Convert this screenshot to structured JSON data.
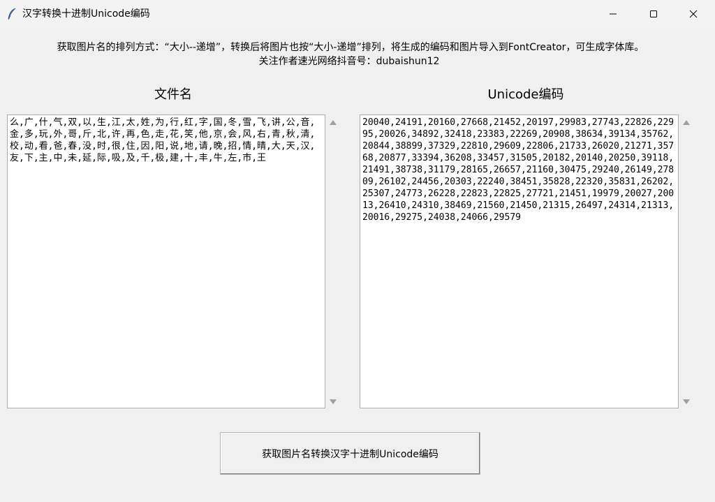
{
  "window": {
    "title": "汉字转换十进制Unicode编码",
    "controls": {
      "minimize": "minimize-icon",
      "maximize": "maximize-icon",
      "close": "close-icon"
    }
  },
  "description": {
    "line1": "获取图片名的排列方式：“大小--递增”，转换后将图片也按“大小-递增”排列，将生成的编码和图片导入到FontCreator，可生成字体库。",
    "line2": "关注作者速光网络抖音号：dubaishun12"
  },
  "left_panel": {
    "label": "文件名",
    "content": "么,广,什,气,双,以,生,江,太,姓,为,行,红,字,国,冬,雪,飞,讲,公,音,金,多,玩,外,哥,斤,北,许,再,色,走,花,笑,他,京,会,风,右,青,秋,清,校,动,看,爸,春,没,时,很,住,因,阳,说,地,请,晚,招,情,晴,大,天,汉,友,下,主,中,未,延,际,吸,及,千,极,建,十,丰,牛,左,市,王"
  },
  "right_panel": {
    "label": "Unicode编码",
    "content": "20040,24191,20160,27668,21452,20197,29983,27743,22826,22995,20026,34892,32418,23383,22269,20908,38634,39134,35762,20844,38899,37329,22810,29609,22806,21733,26020,21271,35768,20877,33394,36208,33457,31505,20182,20140,20250,39118,21491,38738,31179,28165,26657,21160,30475,29240,26149,27809,26102,24456,20303,22240,38451,35828,22320,35831,26202,25307,24773,26228,22823,22825,27721,21451,19979,20027,20013,26410,24310,38469,21560,21450,21315,26497,24314,21313,20016,29275,24038,24066,29579"
  },
  "action_button": {
    "label": "获取图片名转换汉字十进制Unicode编码"
  },
  "colors": {
    "window_bg": "#f0f0f0",
    "textbox_bg": "#ffffff",
    "border": "#adadad",
    "scroll_arrow": "#a0a0a0"
  }
}
